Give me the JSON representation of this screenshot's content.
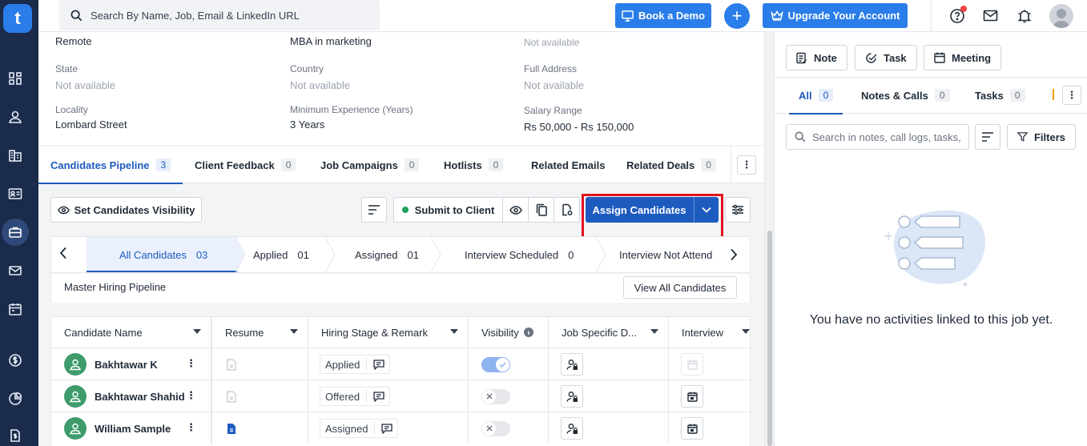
{
  "app": {
    "logo_letter": "t"
  },
  "topbar": {
    "search_placeholder": "Search By Name, Job, Email & LinkedIn URL",
    "book_demo": "Book a Demo",
    "upgrade": "Upgrade Your Account",
    "accent": "#2b7de9"
  },
  "details": {
    "row0": {
      "c1_value": "Remote",
      "c2_value": "MBA in marketing",
      "c3_value": "Not available"
    },
    "row1": {
      "c1_label": "State",
      "c1_value": "Not available",
      "c2_label": "Country",
      "c2_value": "Not available",
      "c3_label": "Full Address",
      "c3_value": "Not available"
    },
    "row2": {
      "c1_label": "Locality",
      "c1_value": "Lombard Street",
      "c2_label": "Minimum Experience (Years)",
      "c2_value": "3 Years",
      "c3_label": "Salary Range",
      "c3_value": "Rs 50,000 - Rs 150,000"
    }
  },
  "tabs": [
    {
      "label": "Candidates Pipeline",
      "count": "3"
    },
    {
      "label": "Client Feedback",
      "count": "0"
    },
    {
      "label": "Job Campaigns",
      "count": "0"
    },
    {
      "label": "Hotlists",
      "count": "0"
    },
    {
      "label": "Related Emails",
      "count": ""
    },
    {
      "label": "Related Deals",
      "count": "0"
    }
  ],
  "toolbar": {
    "visibility": "Set Candidates Visibility",
    "submit": "Submit to Client",
    "assign": "Assign Candidates"
  },
  "stages": [
    {
      "label": "All Candidates",
      "count": "03"
    },
    {
      "label": "Applied",
      "count": "01"
    },
    {
      "label": "Assigned",
      "count": "01"
    },
    {
      "label": "Interview Scheduled",
      "count": "0"
    },
    {
      "label": "Interview Not Attend",
      "count": ""
    }
  ],
  "pipeline": {
    "name": "Master Hiring Pipeline",
    "view_all": "View All Candidates"
  },
  "table": {
    "headers": [
      "Candidate Name",
      "Resume",
      "Hiring Stage & Remark",
      "Visibility",
      "Job Specific D...",
      "Interview"
    ],
    "rows": [
      {
        "name": "Bakhtawar K",
        "stage": "Applied",
        "visible": true,
        "resume": false,
        "interview": false
      },
      {
        "name": "Bakhtawar Shahid",
        "stage": "Offered",
        "visible": false,
        "resume": false,
        "interview": true
      },
      {
        "name": "William Sample",
        "stage": "Assigned",
        "visible": false,
        "resume": true,
        "interview": true
      }
    ]
  },
  "right": {
    "note": "Note",
    "task": "Task",
    "meeting": "Meeting",
    "tabs": [
      {
        "label": "All",
        "count": "0"
      },
      {
        "label": "Notes & Calls",
        "count": "0"
      },
      {
        "label": "Tasks",
        "count": "0"
      }
    ],
    "search_placeholder": "Search in notes, call logs, tasks,",
    "filters": "Filters",
    "empty": "You have no activities linked to this job yet."
  }
}
